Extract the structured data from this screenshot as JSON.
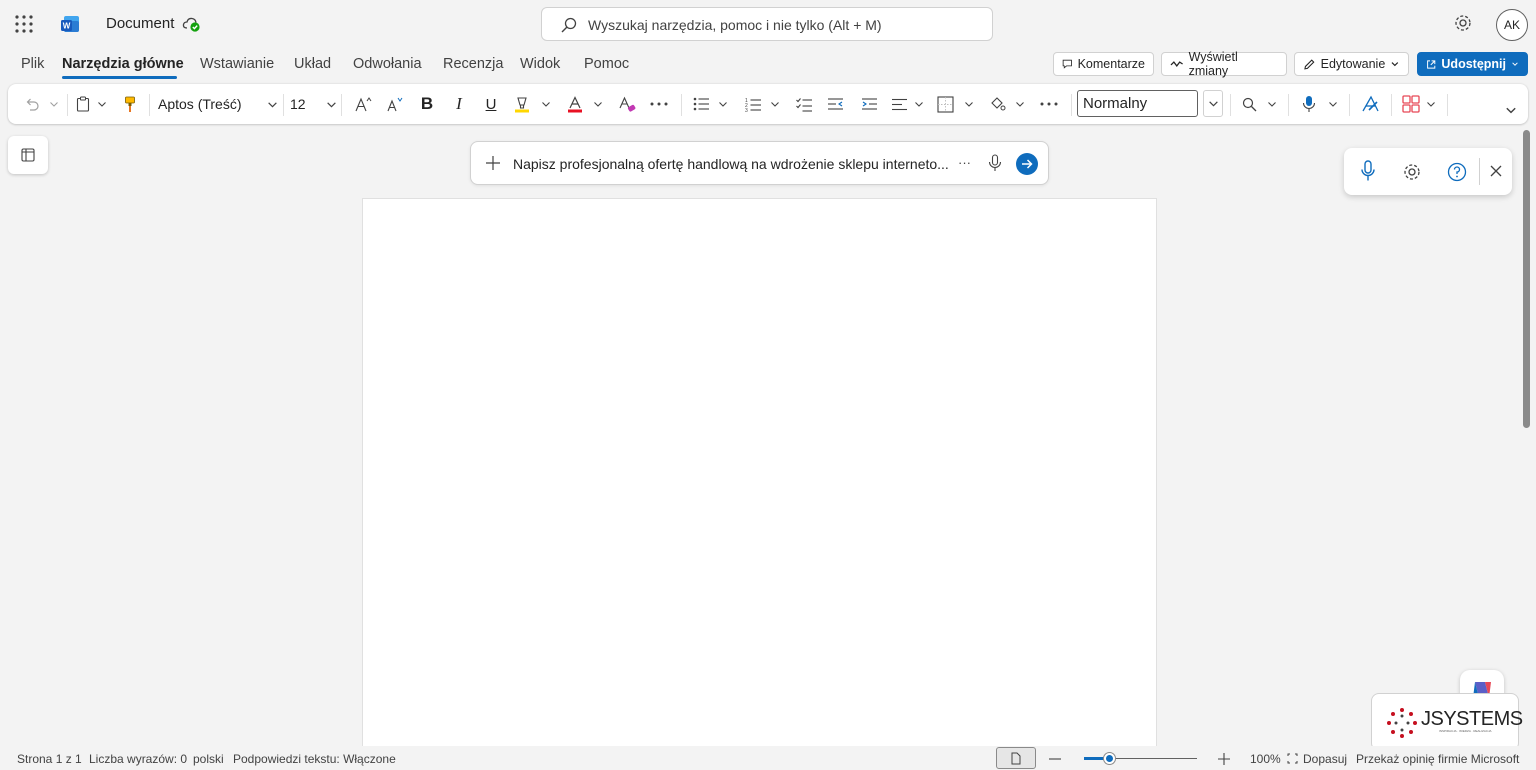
{
  "app": {
    "document_title": "Document",
    "search_placeholder": "Wyszukaj narzędzia, pomoc i nie tylko (Alt + M)",
    "avatar_initials": "AK"
  },
  "ribbon_tabs": [
    "Plik",
    "Narzędzia główne",
    "Wstawianie",
    "Układ",
    "Odwołania",
    "Recenzja",
    "Widok",
    "Pomoc"
  ],
  "active_tab": "Narzędzia główne",
  "ribbon_actions": {
    "comments": "Komentarze",
    "show_changes": "Wyświetl zmiany",
    "editing": "Edytowanie",
    "share": "Udostępnij"
  },
  "toolbar": {
    "font_name": "Aptos (Treść)",
    "font_size": "12",
    "style": "Normalny",
    "font_color": "#e81123"
  },
  "copilot": {
    "prompt": "Napisz profesjonalną ofertę handlową na wdrożenie sklepu interneto...",
    "more": "···"
  },
  "jsystems": {
    "logo_text": "JSYSTEMS",
    "tagline": "INSPIRACJA · WIEDZA · REALIZACJA"
  },
  "statusbar": {
    "page": "Strona 1 z 1",
    "words": "Liczba wyrazów: 0",
    "language": "polski",
    "predictions": "Podpowiedzi tekstu: Włączone",
    "zoom": "100%",
    "fit": "Dopasuj",
    "feedback": "Przekaż opinię firmie Microsoft"
  },
  "colors": {
    "accent": "#0f6cbd",
    "word_blue": "#185abd",
    "sync_green": "#13a10e"
  },
  "icons": [
    "app-launcher-icon",
    "word-logo-icon",
    "cloud-saved-icon",
    "search-icon",
    "settings-icon",
    "undo-icon",
    "paste-icon",
    "format-painter-icon",
    "grow-font-icon",
    "shrink-font-icon",
    "bold-icon",
    "italic-icon",
    "underline-icon",
    "highlight-icon",
    "font-color-icon",
    "clear-formatting-icon",
    "bullets-icon",
    "numbering-icon",
    "checklist-icon",
    "decrease-indent-icon",
    "increase-indent-icon",
    "align-icon",
    "borders-icon",
    "shading-icon",
    "find-icon",
    "dictate-icon",
    "editor-icon",
    "add-ins-icon",
    "microphone-icon",
    "help-icon",
    "close-icon"
  ]
}
